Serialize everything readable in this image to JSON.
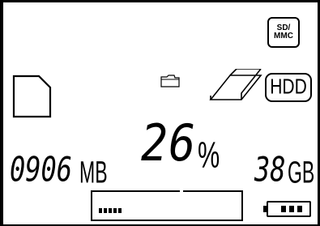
{
  "device": {
    "sd_badge": {
      "line1": "SD/",
      "line2": "MMC"
    },
    "hdd_badge": "HDD",
    "progress": {
      "percent_value": "26",
      "percent_sign": "%",
      "fill_fraction": 0.26
    },
    "left_readout": {
      "value": "0906",
      "unit": "MB"
    },
    "right_readout": {
      "value": "38",
      "unit": "GB"
    },
    "progress_bar_level": 0.26,
    "battery_level": 0.75
  },
  "icons": {
    "card": "memory-card-icon",
    "folder": "folder-icon",
    "drive": "hard-drive-icon",
    "battery": "battery-icon"
  }
}
